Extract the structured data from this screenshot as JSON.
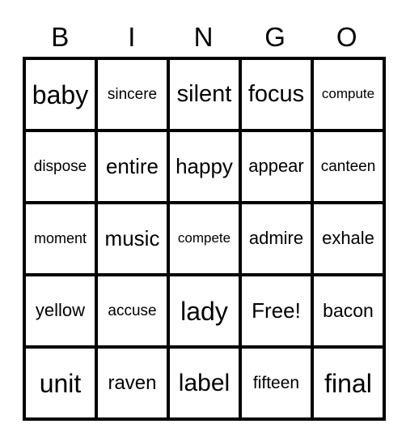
{
  "header": {
    "letters": [
      "B",
      "I",
      "N",
      "G",
      "O"
    ]
  },
  "card": {
    "rows": [
      [
        "baby",
        "sincere",
        "silent",
        "focus",
        "compute"
      ],
      [
        "dispose",
        "entire",
        "happy",
        "appear",
        "canteen"
      ],
      [
        "moment",
        "music",
        "compete",
        "admire",
        "exhale"
      ],
      [
        "yellow",
        "accuse",
        "lady",
        "Free!",
        "bacon"
      ],
      [
        "unit",
        "raven",
        "label",
        "fifteen",
        "final"
      ]
    ]
  }
}
